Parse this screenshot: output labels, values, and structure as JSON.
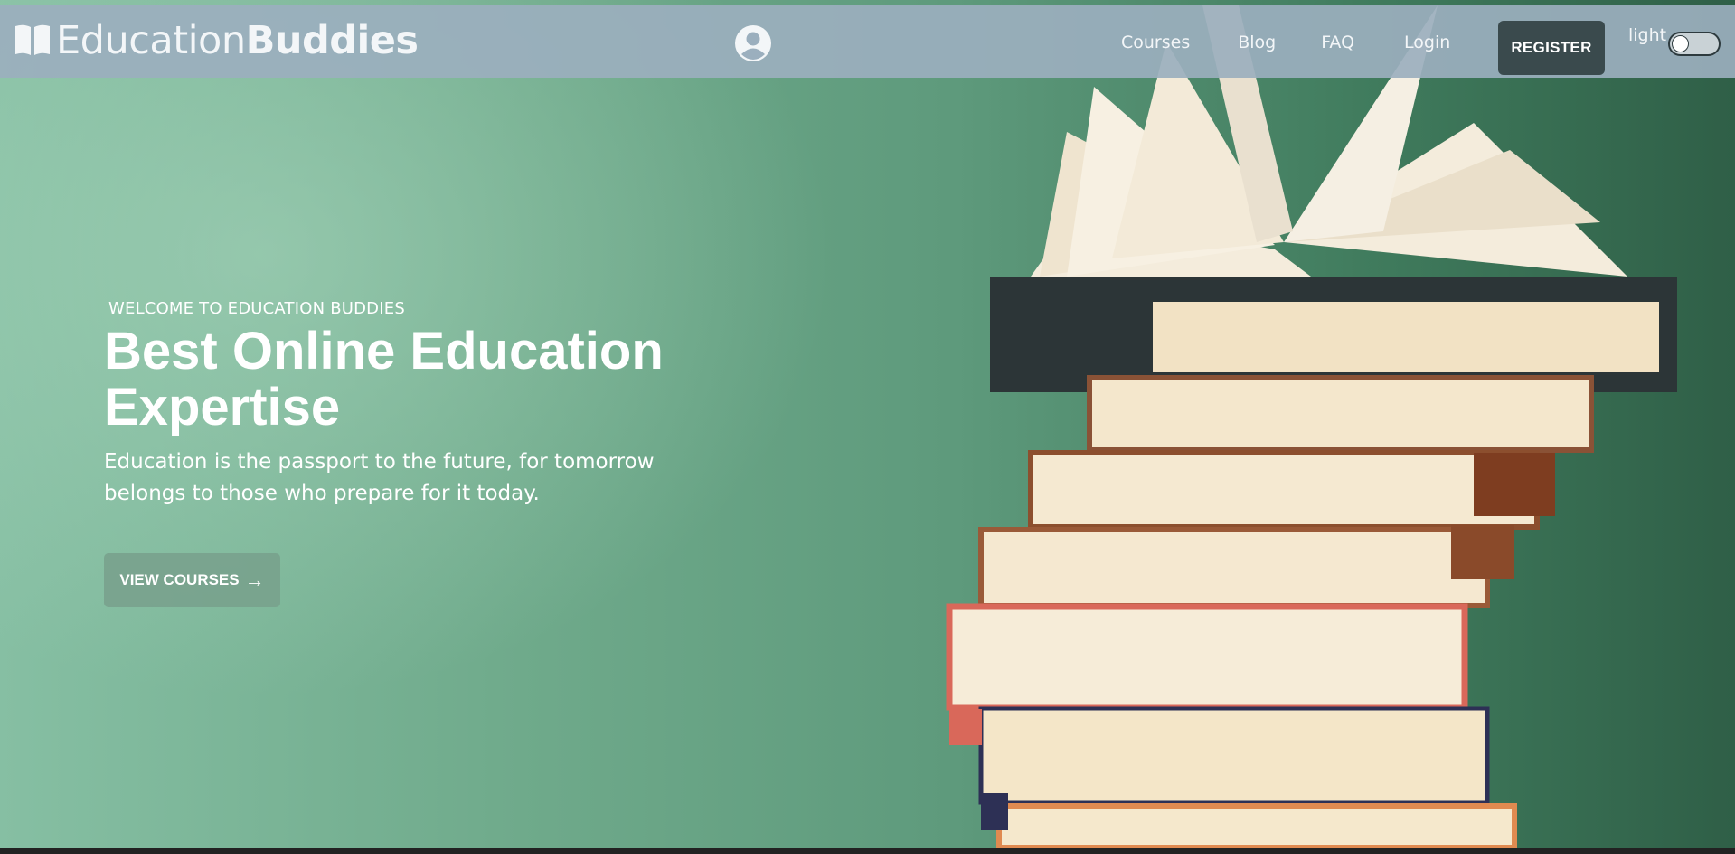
{
  "brand": {
    "name_regular": "Education",
    "name_bold": "Buddies"
  },
  "nav": {
    "links": [
      "Courses",
      "Blog",
      "FAQ",
      "Login"
    ],
    "register": "REGISTER",
    "theme_label": "light"
  },
  "hero": {
    "eyebrow": "WELCOME TO EDUCATION BUDDIES",
    "headline": "Best Online Education Expertise",
    "subtext": "Education is the passport to the future, for tomorrow belongs to those who prepare for it today.",
    "cta_label": "VIEW COURSES",
    "cta_icon": "arrow-right-icon"
  },
  "colors": {
    "navbar": "#9bafbe",
    "register_bg": "#3a4a4d",
    "hero_green": "#5e9a7c"
  }
}
